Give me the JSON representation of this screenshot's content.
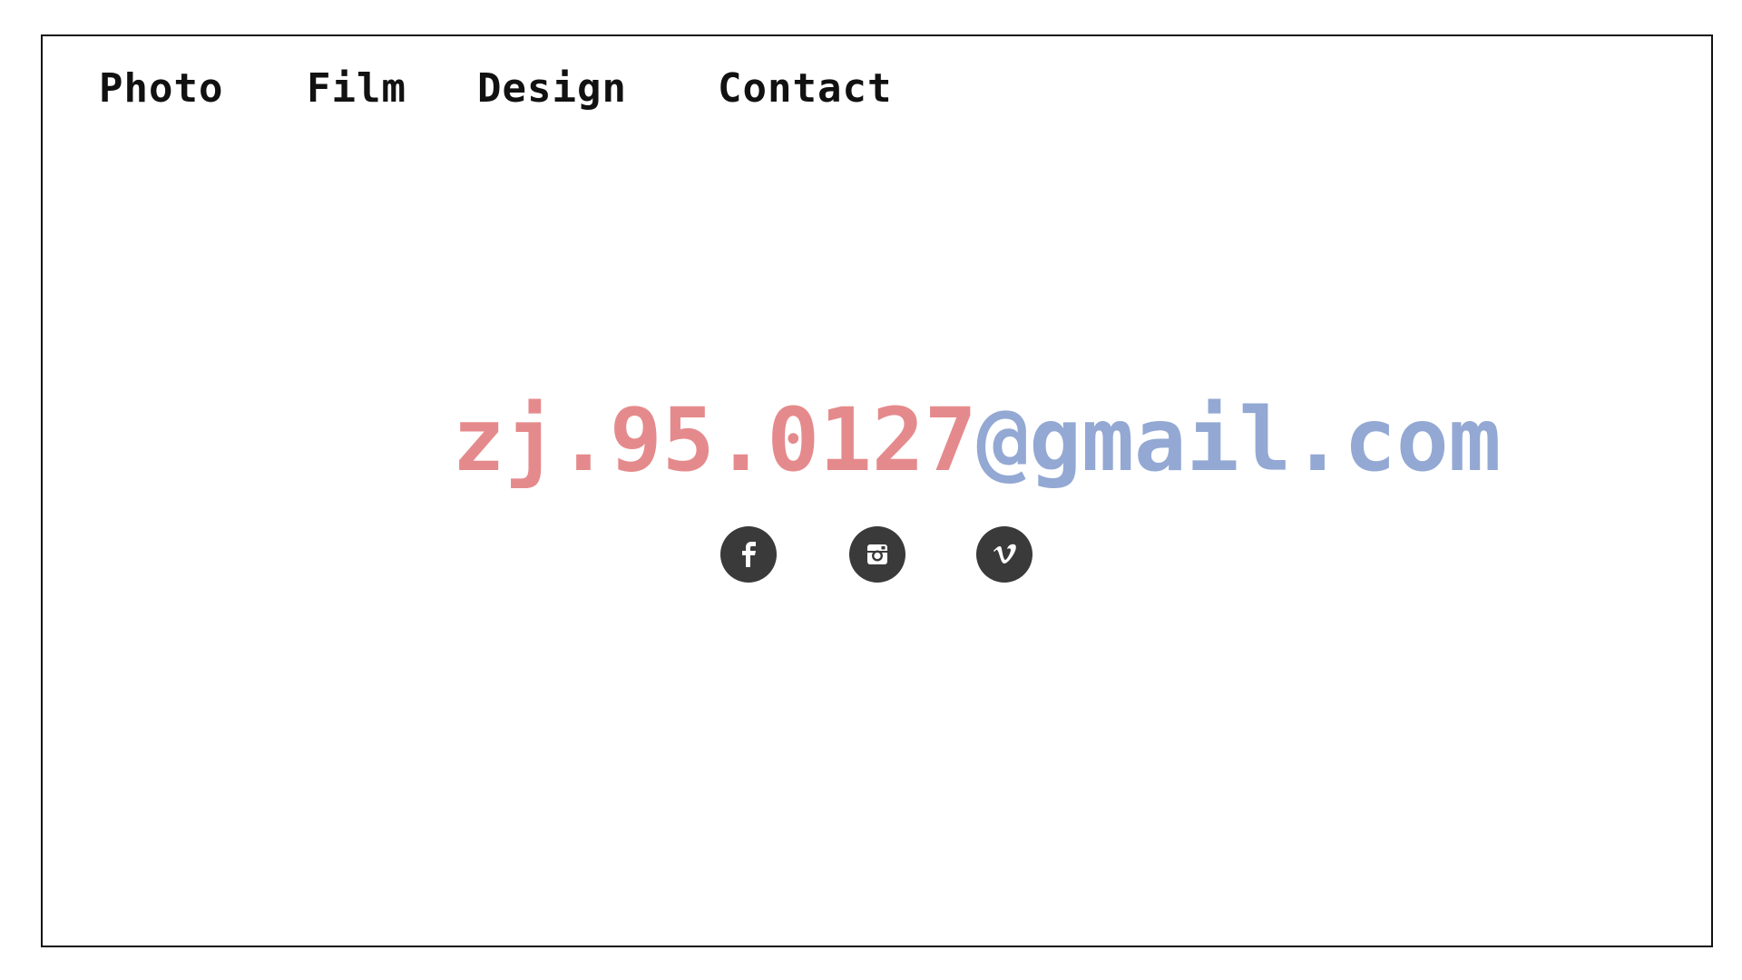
{
  "nav": {
    "items": [
      {
        "label": "Photo"
      },
      {
        "label": "Film"
      },
      {
        "label": "Design"
      },
      {
        "label": "Contact"
      }
    ]
  },
  "contact": {
    "email_local": "zj.95.0127",
    "email_domain": "@gmail.com",
    "colors": {
      "local": "#e58a8c",
      "domain": "#93a8d3"
    }
  },
  "social": [
    {
      "icon": "facebook-icon"
    },
    {
      "icon": "instagram-icon"
    },
    {
      "icon": "vimeo-icon"
    }
  ],
  "colors": {
    "nav_text": "#111111",
    "icon_bg": "#3a3a3a",
    "border": "#111111"
  }
}
